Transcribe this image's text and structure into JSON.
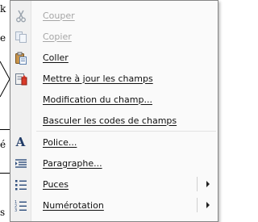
{
  "document_fragments": [
    "k",
    "e",
    "é",
    "s"
  ],
  "menu": {
    "items": [
      {
        "label": "Couper",
        "icon": "scissors-icon",
        "disabled": true
      },
      {
        "label": "Copier",
        "icon": "copy-icon",
        "disabled": true
      },
      {
        "label": "Coller",
        "icon": "paste-icon",
        "disabled": false
      },
      {
        "label": "Mettre à jour les champs",
        "icon": "update-field-icon",
        "disabled": false
      },
      {
        "label": "Modification du champ...",
        "icon": "",
        "disabled": false
      },
      {
        "label": "Basculer les codes de champs",
        "icon": "",
        "disabled": false
      },
      {
        "label": "Police...",
        "icon": "font-icon",
        "disabled": false
      },
      {
        "label": "Paragraphe...",
        "icon": "paragraph-icon",
        "disabled": false
      },
      {
        "label": "Puces",
        "icon": "bullets-icon",
        "disabled": false,
        "submenu": true
      },
      {
        "label": "Numérotation",
        "icon": "numbering-icon",
        "disabled": false,
        "submenu": true
      }
    ]
  }
}
